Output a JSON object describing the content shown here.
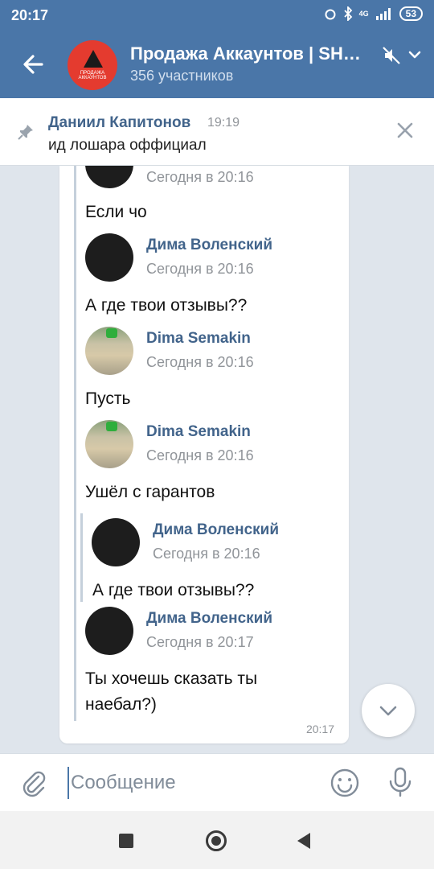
{
  "status_bar": {
    "time": "20:17",
    "network": "4G",
    "battery": "53"
  },
  "header": {
    "title": "Продажа Аккаунтов | SH…",
    "subtitle": "356 участников",
    "avatar_caption": "ПРОДАЖА АККАУНТОВ"
  },
  "pinned": {
    "author": "Даниил Капитонов",
    "time": "19:19",
    "text": "ид лошара оффициал"
  },
  "messages": [
    {
      "name": "",
      "time": "Сегодня в 20:16",
      "text": "Если чо"
    },
    {
      "name": "Дима Воленский",
      "time": "Сегодня в 20:16",
      "text": "А где твои отзывы??"
    },
    {
      "name": "Dima Semakin",
      "time": "Сегодня в 20:16",
      "text": "Пусть"
    },
    {
      "name": "Dima Semakin",
      "time": "Сегодня в 20:16",
      "text": "Ушёл с гарантов"
    },
    {
      "name": "Дима Воленский",
      "time": "Сегодня в 20:16",
      "text": "А где твои отзывы??"
    },
    {
      "name": "Дима Воленский",
      "time": "Сегодня в 20:17",
      "text": "Ты хочешь сказать ты наебал?)"
    }
  ],
  "card_time": "20:17",
  "composer": {
    "placeholder": "Сообщение"
  },
  "colors": {
    "accent": "#4a76a8",
    "link": "#42648b",
    "muted": "#909499"
  }
}
